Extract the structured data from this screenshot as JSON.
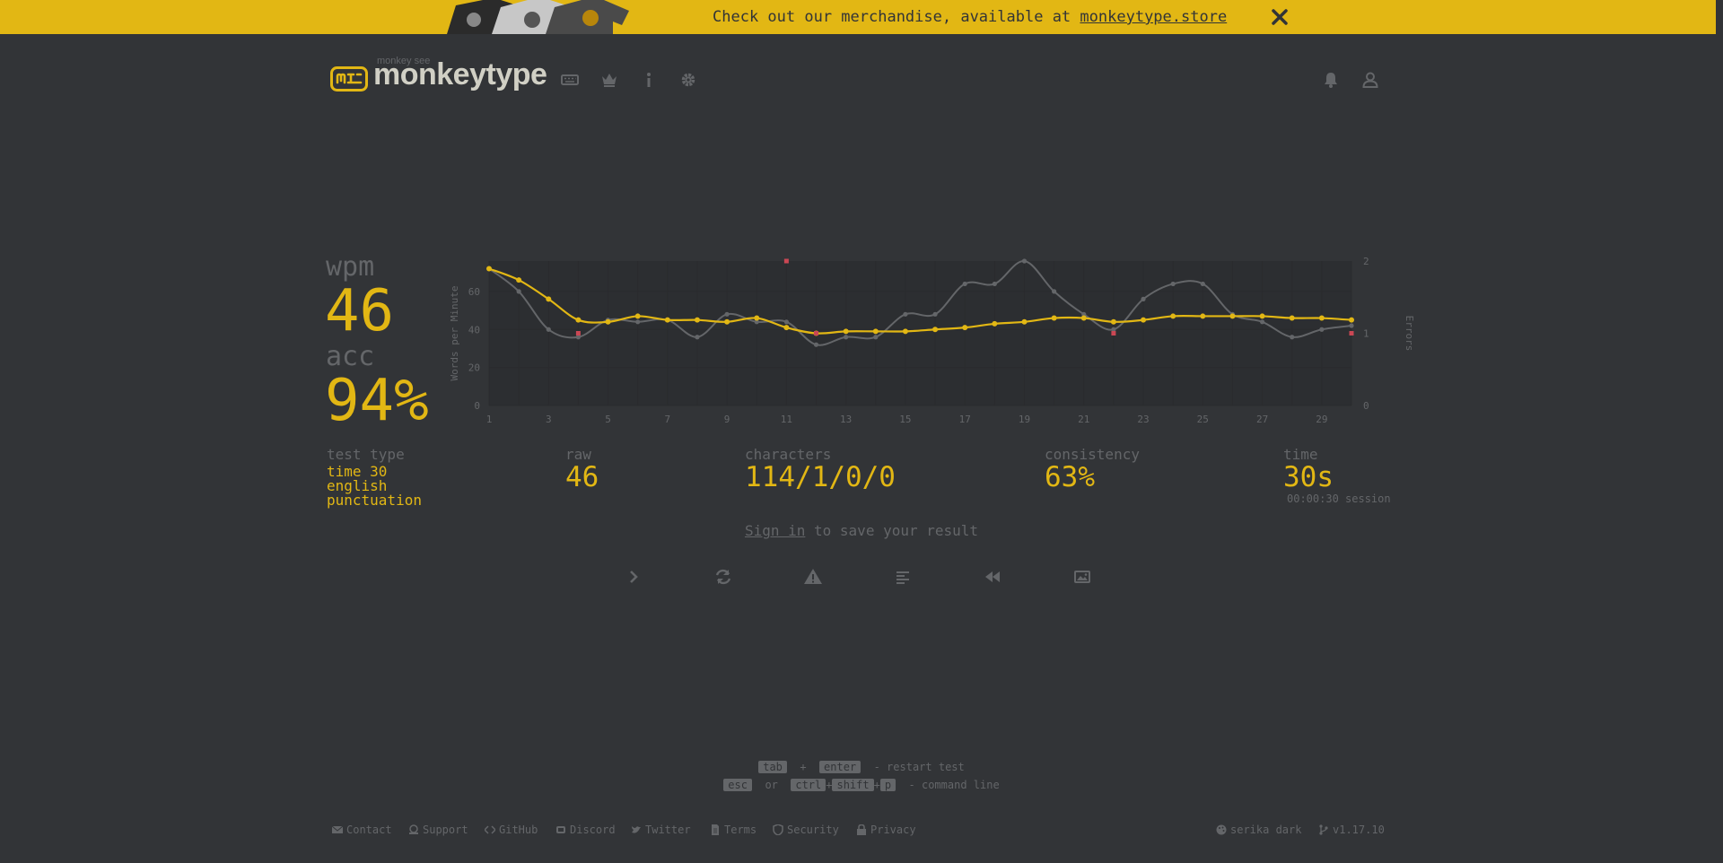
{
  "banner": {
    "text": "Check out our merchandise, available at",
    "link": "monkeytype.store"
  },
  "header": {
    "logo_small": "monkey see",
    "logo_text": "monkeytype"
  },
  "stats": {
    "wpm_label": "wpm",
    "wpm_value": "46",
    "acc_label": "acc",
    "acc_value": "94%",
    "test_type_label": "test type",
    "test_type_values": [
      "time 30",
      "english",
      "punctuation"
    ],
    "raw_label": "raw",
    "raw_value": "46",
    "characters_label": "characters",
    "characters_value": "114/1/0/0",
    "consistency_label": "consistency",
    "consistency_value": "63%",
    "time_label": "time",
    "time_value": "30s",
    "session": "00:00:30 session"
  },
  "signin": {
    "link": "Sign in",
    "text": "to save your result"
  },
  "shortcuts": {
    "line1_keys": [
      "tab",
      "enter"
    ],
    "line1_text": "- restart test",
    "line2_key1": "esc",
    "line2_or": "or",
    "line2_keys": [
      "ctrl",
      "shift",
      "p"
    ],
    "line2_text": "- command line"
  },
  "footer": {
    "links": [
      "Contact",
      "Support",
      "GitHub",
      "Discord",
      "Twitter",
      "Terms",
      "Security",
      "Privacy"
    ],
    "theme": "serika dark",
    "version": "v1.17.10"
  },
  "colors": {
    "background": "#323437",
    "accent": "#e2b714",
    "text": "#d1d0c5",
    "subtext": "#646669",
    "error": "#ca4754"
  },
  "chart_data": {
    "type": "line",
    "xlabel": "",
    "ylabel": "Words per Minute",
    "y2label": "Errors",
    "x": [
      1,
      2,
      3,
      4,
      5,
      6,
      7,
      8,
      9,
      10,
      11,
      12,
      13,
      14,
      15,
      16,
      17,
      18,
      19,
      20,
      21,
      22,
      23,
      24,
      25,
      26,
      27,
      28,
      29,
      30
    ],
    "x_ticks": [
      1,
      3,
      5,
      7,
      9,
      11,
      13,
      15,
      17,
      19,
      21,
      23,
      25,
      27,
      29
    ],
    "ylim": [
      0,
      76
    ],
    "y_ticks": [
      0,
      20,
      40,
      60
    ],
    "y2lim": [
      0,
      2
    ],
    "y2_ticks": [
      0,
      1,
      2
    ],
    "grid": true,
    "series": [
      {
        "role": "wpm",
        "values": [
          72,
          66,
          56,
          45,
          44,
          47,
          45,
          45,
          44,
          46,
          41,
          38,
          39,
          39,
          39,
          40,
          41,
          43,
          44,
          46,
          46,
          44,
          45,
          47,
          47,
          47,
          47,
          46,
          46,
          45
        ]
      },
      {
        "role": "raw",
        "values": [
          72,
          60,
          40,
          36,
          45,
          44,
          45,
          36,
          48,
          44,
          44,
          32,
          36,
          36,
          48,
          48,
          64,
          64,
          76,
          60,
          48,
          40,
          56,
          64,
          64,
          48,
          44,
          36,
          40,
          42
        ]
      }
    ],
    "errors": [
      {
        "x": 4,
        "value": 1
      },
      {
        "x": 11,
        "value": 2
      },
      {
        "x": 12,
        "value": 1
      },
      {
        "x": 22,
        "value": 1
      },
      {
        "x": 30,
        "value": 1
      }
    ]
  }
}
